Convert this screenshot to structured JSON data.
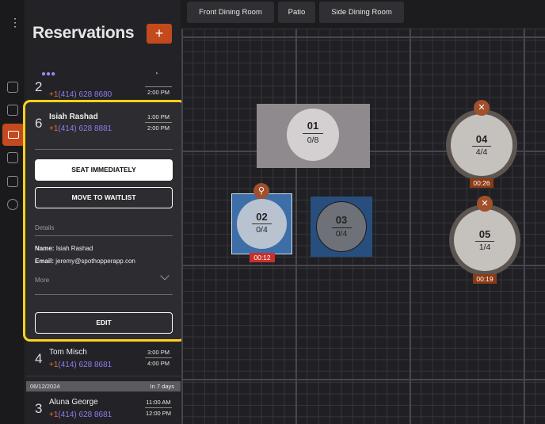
{
  "app": {
    "title": "Reservations",
    "add_label": "+"
  },
  "tabs": [
    {
      "label": "Front Dining Room"
    },
    {
      "label": "Patio"
    },
    {
      "label": "Side Dining Room"
    }
  ],
  "list": {
    "header_icons": [
      "guests-icon",
      "clock-icon"
    ],
    "top_row": {
      "number": "2",
      "phone_cc": "+1",
      "phone": "(414) 628 8680",
      "time_end": "2:00 PM"
    },
    "selected": {
      "number": "6",
      "name": "Isiah Rashad",
      "phone_cc": "+1",
      "phone": "(414) 628 8881",
      "time_start": "1:00 PM",
      "time_end": "2:00 PM",
      "seat_label": "SEAT IMMEDIATELY",
      "waitlist_label": "MOVE TO WAITLIST",
      "details_label": "Details",
      "name_key": "Name:",
      "name_val": "Isiah Rashad",
      "email_key": "Email:",
      "email_val": "jeremy@spothopperapp.con",
      "more_label": "More",
      "edit_label": "EDIT"
    },
    "row4": {
      "number": "4",
      "name": "Tom Misch",
      "phone_cc": "+1",
      "phone": "(414) 628 8681",
      "time_start": "3:00 PM",
      "time_end": "4:00 PM"
    },
    "date_divider": {
      "date": "06/12/2024",
      "relative": "In 7 days"
    },
    "row3": {
      "number": "3",
      "name": "Aluna George",
      "phone_cc": "+1",
      "phone": "(414) 628 8681",
      "time_start": "11:00 AM",
      "time_end": "12:00 PM"
    }
  },
  "floor": {
    "tables": [
      {
        "id": "01",
        "capacity": "0/8"
      },
      {
        "id": "02",
        "capacity": "0/4",
        "timer": "00:12",
        "badge": "walking-person-icon"
      },
      {
        "id": "03",
        "capacity": "0/4"
      },
      {
        "id": "04",
        "capacity": "4/4",
        "timer": "00:26",
        "badge": "fork-knife-icon"
      },
      {
        "id": "05",
        "capacity": "1/4",
        "timer": "00:19",
        "badge": "fork-knife-icon"
      }
    ]
  },
  "colors": {
    "accent": "#c24a1c",
    "highlight": "#ffd21a",
    "phone": "#8d7cf0",
    "timer_red": "#c9302c",
    "timer_brown": "#8a3a14"
  }
}
